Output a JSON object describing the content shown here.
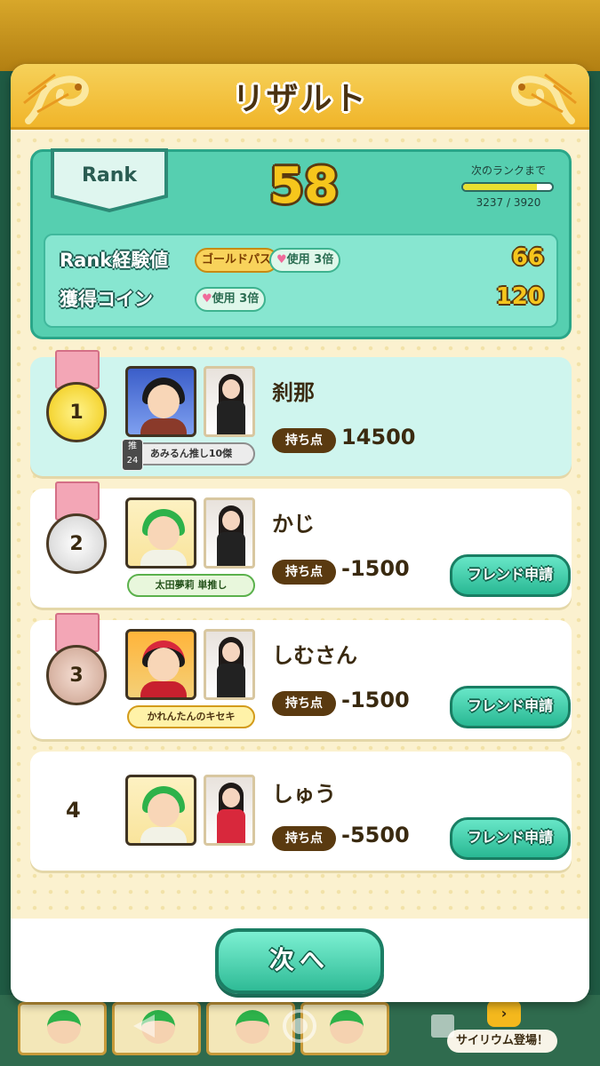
{
  "header": {
    "title": "リザルト"
  },
  "rank": {
    "badge_label": "Rank",
    "level": "58",
    "next_label": "次のランクまで",
    "progress_text": "3237 / 3920",
    "progress_fraction": 0.826
  },
  "rewards": {
    "exp_label": "Rank経験値",
    "exp_gold_pill": "ゴールドパス",
    "exp_multiplier": "使用 3倍",
    "exp_value": "66",
    "coin_label": "獲得コイン",
    "coin_multiplier": "使用 3倍",
    "coin_value": "120"
  },
  "results": [
    {
      "rank": "1",
      "medal": "gold",
      "name": "刹那",
      "score_label": "持ち点",
      "score": "14500",
      "tag": "あみるん推し10傑",
      "oshi_badge": "推 24",
      "highlight": true
    },
    {
      "rank": "2",
      "medal": "silver",
      "name": "かじ",
      "score_label": "持ち点",
      "score": "-1500",
      "tag": "太田夢莉 単推し",
      "friend_button": "フレンド申請"
    },
    {
      "rank": "3",
      "medal": "bronze",
      "name": "しむさん",
      "score_label": "持ち点",
      "score": "-1500",
      "tag": "かれんたんのキセキ",
      "friend_button": "フレンド申請"
    },
    {
      "rank": "4",
      "medal": "none",
      "name": "しゅう",
      "score_label": "持ち点",
      "score": "-5500",
      "friend_button": "フレンド申請"
    }
  ],
  "footer": {
    "next_button": "次へ"
  },
  "background": {
    "banner_text": "サイリウム登場！"
  },
  "colors": {
    "teal": "#56cfb0",
    "gold": "#f6c61c",
    "brown": "#5a3a10",
    "header_gold": "#f0b52a"
  }
}
